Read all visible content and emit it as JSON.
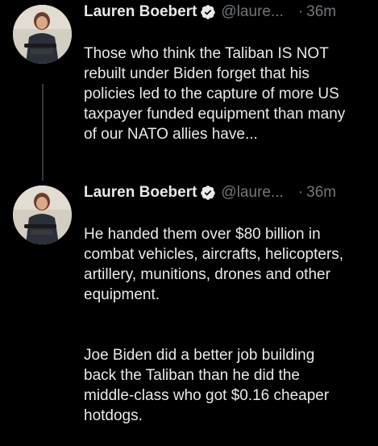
{
  "colors": {
    "background": "#000000",
    "text": "#e7e9ea",
    "muted": "#71767b",
    "verified_badge": "#1d9bf0",
    "thread_line": "#333639"
  },
  "tweets": [
    {
      "author_name": "Lauren Boebert",
      "verified_icon": "verified-badge-icon",
      "handle": "@laure...",
      "separator": "·",
      "time": "36m",
      "paragraphs": [
        "Those who think the Taliban IS NOT\nrebuilt under Biden forget that his\npolicies led to the capture of more US\ntaxpayer funded equipment than many\nof our NATO allies have..."
      ]
    },
    {
      "author_name": "Lauren Boebert",
      "verified_icon": "verified-badge-icon",
      "handle": "@laure...",
      "separator": "·",
      "time": "36m",
      "paragraphs": [
        "He handed them over $80 billion in\ncombat vehicles, aircrafts, helicopters,\nartillery, munitions, drones and other\nequipment.",
        "Joe Biden did a better job building\nback the Taliban than he did the\nmiddle-class who got $0.16 cheaper\nhotdogs."
      ]
    }
  ]
}
